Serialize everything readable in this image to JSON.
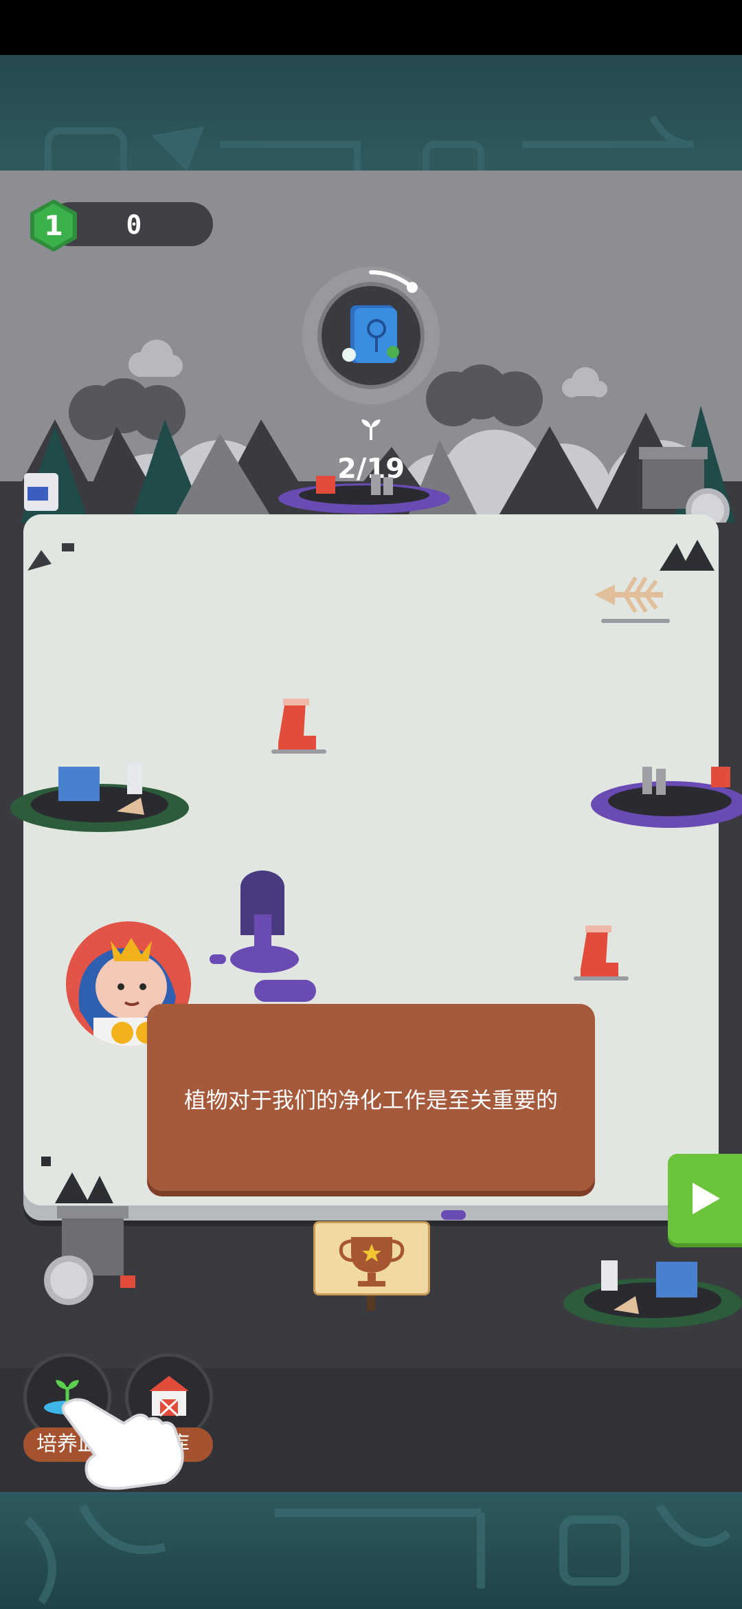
{
  "hud": {
    "level": "1",
    "score": "0"
  },
  "collection": {
    "progress": "2/19",
    "icon": "seedling-icon"
  },
  "dialog": {
    "text": "植物对于我们的净化工作是至关重要的"
  },
  "nav": {
    "items": [
      {
        "label": "培养皿",
        "icon": "petri-dish-icon"
      },
      {
        "label": "仓库",
        "icon": "barn-icon"
      }
    ]
  },
  "colors": {
    "dialog": "#a65a3c",
    "next_button": "#6cc43a",
    "level_badge": "#3bb04b",
    "pollution": "#6a4bb3"
  }
}
